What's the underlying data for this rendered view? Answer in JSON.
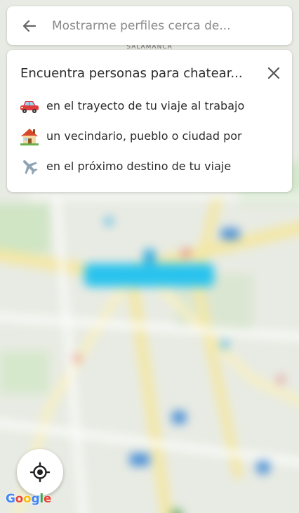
{
  "search": {
    "placeholder": "Mostrarme perfiles cerca de..."
  },
  "map": {
    "district_label": "SALAMANCA"
  },
  "card": {
    "title": "Encuentra personas para chatear...",
    "suggestions": [
      {
        "icon": "car-icon",
        "text": "en el trayecto de tu viaje al trabajo"
      },
      {
        "icon": "house-icon",
        "text": "un vecindario, pueblo o ciudad por"
      },
      {
        "icon": "airplane-icon",
        "text": "en el próximo destino de tu viaje"
      }
    ]
  },
  "branding": {
    "logo_text": "Google",
    "logo_colors": [
      "#4285F4",
      "#EA4335",
      "#FBBC05",
      "#4285F4",
      "#34A853",
      "#EA4335"
    ]
  },
  "colors": {
    "accent_blue": "#29c3ee",
    "icon_gray": "#666666"
  }
}
